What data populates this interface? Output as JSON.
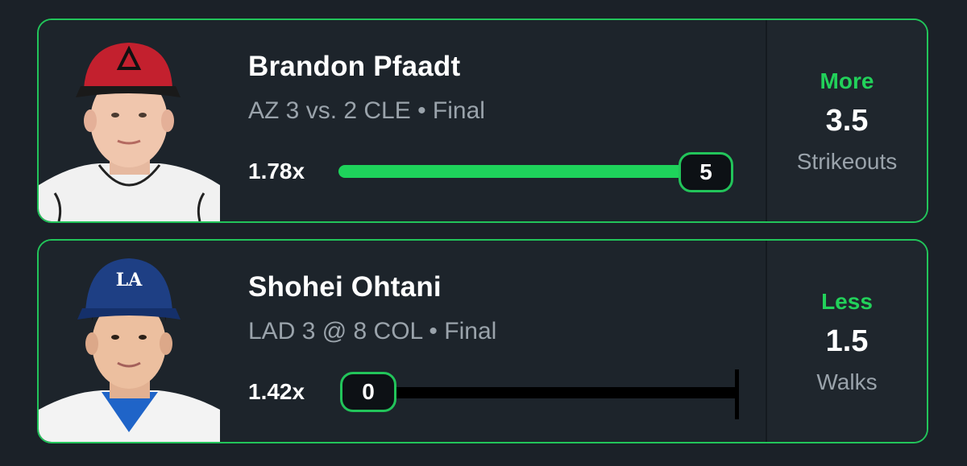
{
  "picks": [
    {
      "player": "Brandon Pfaadt",
      "game": "AZ 3 vs. 2 CLE • Final",
      "multiplier": "1.78x",
      "current_value": "5",
      "progress": 1.0,
      "pick": "More",
      "line": "3.5",
      "stat": "Strikeouts",
      "accent_color": "#22d15a"
    },
    {
      "player": "Shohei Ohtani",
      "game": "LAD 3 @ 8 COL • Final",
      "multiplier": "1.42x",
      "current_value": "0",
      "progress": 0.0,
      "pick": "Less",
      "line": "1.5",
      "stat": "Walks",
      "accent_color": "#22d15a"
    }
  ]
}
